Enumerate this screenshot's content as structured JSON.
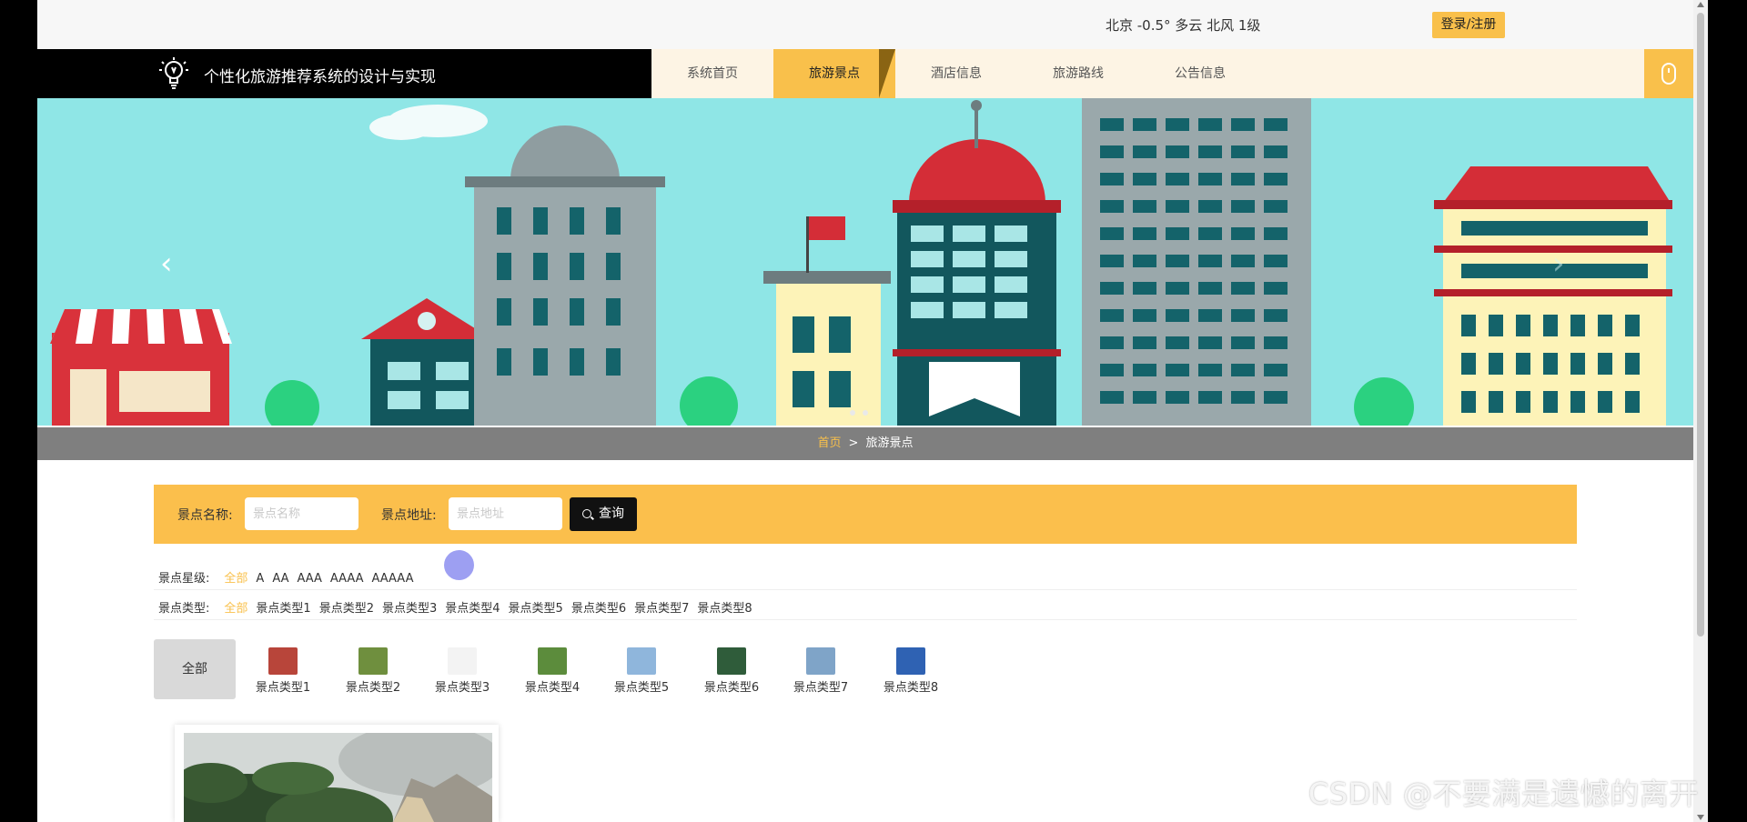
{
  "topbar": {
    "weather": "北京  -0.5°  多云  北风  1级",
    "login_label": "登录/注册"
  },
  "brand": {
    "title": "个性化旅游推荐系统的设计与实现"
  },
  "nav": {
    "items": [
      "系统首页",
      "旅游景点",
      "酒店信息",
      "旅游路线",
      "公告信息"
    ],
    "active": "旅游景点"
  },
  "banner": {
    "prev_glyph": "‹",
    "next_glyph": "›"
  },
  "breadcrumb": {
    "home": "首页",
    "separator": ">",
    "current": "旅游景点"
  },
  "search": {
    "name_label": "景点名称:",
    "name_placeholder": "景点名称",
    "address_label": "景点地址:",
    "address_placeholder": "景点地址",
    "button_label": "查询"
  },
  "filters": {
    "star": {
      "label": "景点星级:",
      "options": [
        "全部",
        "A",
        "AA",
        "AAA",
        "AAAA",
        "AAAAA"
      ]
    },
    "type": {
      "label": "景点类型:",
      "options": [
        "全部",
        "景点类型1",
        "景点类型2",
        "景点类型3",
        "景点类型4",
        "景点类型5",
        "景点类型6",
        "景点类型7",
        "景点类型8"
      ]
    }
  },
  "categories": {
    "all_label": "全部",
    "items": [
      {
        "name": "景点类型1",
        "color": "#b8453a"
      },
      {
        "name": "景点类型2",
        "color": "#6f8f3e"
      },
      {
        "name": "景点类型3",
        "color": "#f3f3f3"
      },
      {
        "name": "景点类型4",
        "color": "#5c8c3c"
      },
      {
        "name": "景点类型5",
        "color": "#8fb6dc"
      },
      {
        "name": "景点类型6",
        "color": "#2f5c3a"
      },
      {
        "name": "景点类型7",
        "color": "#7fa4c8"
      },
      {
        "name": "景点类型8",
        "color": "#2f62b3"
      }
    ]
  },
  "watermark": "CSDN @不要满是遗憾的离开",
  "colors": {
    "accent": "#f9c04b",
    "nav_bg": "#fdf4e4",
    "breadcrumb_bg": "#7f7f7f"
  }
}
